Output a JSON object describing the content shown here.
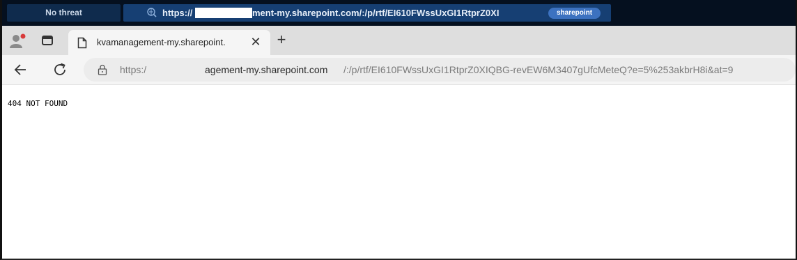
{
  "analysis_bar": {
    "verdict": "No threat",
    "url_start": "https://",
    "url_rest": "ment-my.sharepoint.com/:/p/rtf/EI610FWssUxGI1RtprZ0XI",
    "tag": "sharepoint"
  },
  "browser": {
    "tab": {
      "title": "kvamanagement-my.sharepoint."
    },
    "address": {
      "scheme": "https:/",
      "host": "agement-my.sharepoint.com",
      "path": "/:/p/rtf/EI610FWssUxGI1RtprZ0XIQBG-revEW6M3407gUfcMeteQ?e=5%253akbrH8i&at=9"
    }
  },
  "page": {
    "message": "404 NOT FOUND"
  },
  "colors": {
    "topbar": "#05101f",
    "verdict_bg": "#0f2b4d",
    "url_panel": "#163f73",
    "tag_bg": "#3c72c0"
  },
  "icons": [
    "globe-search-icon",
    "profile-icon",
    "tab-actions-icon",
    "document-icon",
    "close-icon",
    "plus-icon",
    "back-arrow-icon",
    "reload-icon",
    "lock-icon"
  ]
}
